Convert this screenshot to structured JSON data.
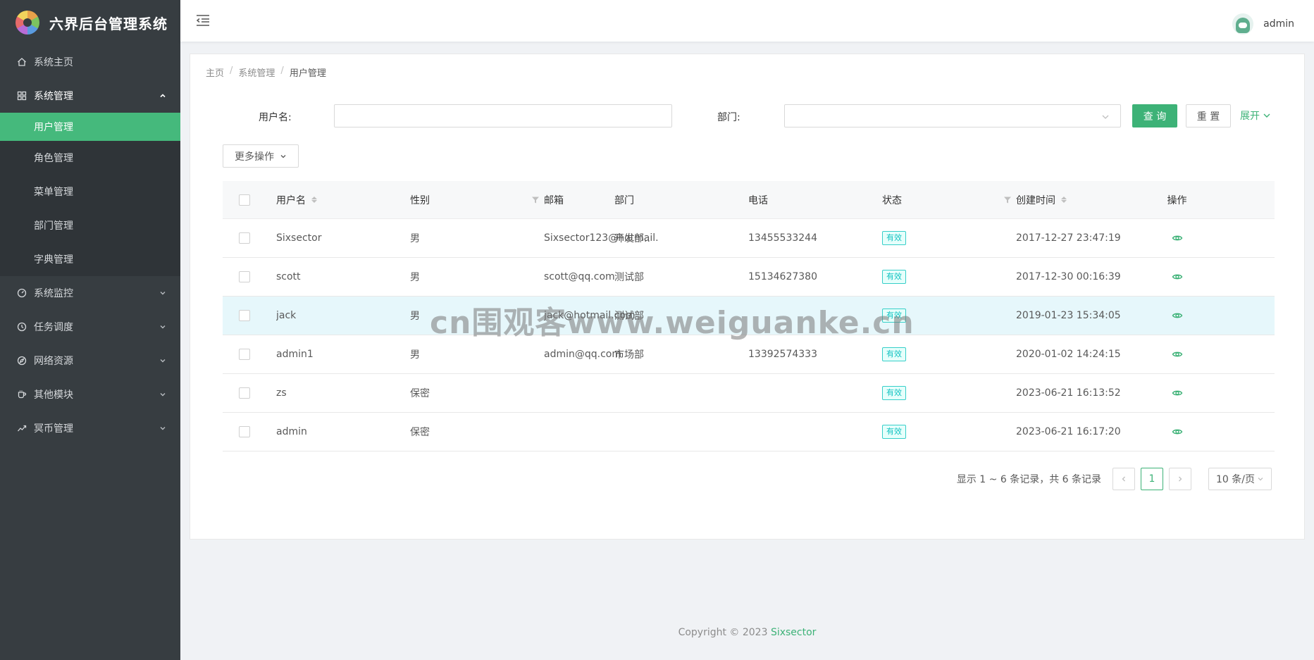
{
  "app": {
    "title": "六界后台管理系统"
  },
  "sidebar": {
    "items": [
      {
        "label": "系统主页",
        "icon": "home-icon"
      },
      {
        "label": "系统管理",
        "icon": "grid-icon",
        "expanded": true,
        "children": [
          {
            "label": "用户管理",
            "active": true
          },
          {
            "label": "角色管理"
          },
          {
            "label": "菜单管理"
          },
          {
            "label": "部门管理"
          },
          {
            "label": "字典管理"
          }
        ]
      },
      {
        "label": "系统监控",
        "icon": "dashboard-icon"
      },
      {
        "label": "任务调度",
        "icon": "clock-icon"
      },
      {
        "label": "网络资源",
        "icon": "compass-icon"
      },
      {
        "label": "其他模块",
        "icon": "coffee-icon"
      },
      {
        "label": "冥币管理",
        "icon": "line-chart-icon"
      }
    ]
  },
  "header": {
    "username": "admin"
  },
  "breadcrumb": {
    "home": "主页",
    "parent": "系统管理",
    "current": "用户管理",
    "sep": "/"
  },
  "search": {
    "username_label": "用户名:",
    "username_value": "",
    "dept_label": "部门:",
    "dept_value": "",
    "query_button": "查 询",
    "reset_button": "重 置",
    "expand_link": "展开"
  },
  "toolbar": {
    "more_actions": "更多操作"
  },
  "table": {
    "columns": {
      "username": "用户名",
      "sex": "性别",
      "email": "邮箱",
      "dept": "部门",
      "phone": "电话",
      "status": "状态",
      "created": "创建时间",
      "ops": "操作"
    },
    "rows": [
      {
        "username": "Sixsector",
        "sex": "男",
        "email": "Sixsector123@hotmail.",
        "dept": "开发部..",
        "phone": "13455533244",
        "status": "有效",
        "created": "2017-12-27 23:47:19"
      },
      {
        "username": "scott",
        "sex": "男",
        "email": "scott@qq.com",
        "dept": "测试部",
        "phone": "15134627380",
        "status": "有效",
        "created": "2017-12-30 00:16:39"
      },
      {
        "username": "jack",
        "sex": "男",
        "email": "jack@hotmail.com",
        "dept": "测试部",
        "phone": "",
        "status": "有效",
        "created": "2019-01-23 15:34:05"
      },
      {
        "username": "admin1",
        "sex": "男",
        "email": "admin@qq.com",
        "dept": "市场部",
        "phone": "13392574333",
        "status": "有效",
        "created": "2020-01-02 14:24:15"
      },
      {
        "username": "zs",
        "sex": "保密",
        "email": "",
        "dept": "",
        "phone": "",
        "status": "有效",
        "created": "2023-06-21 16:13:52"
      },
      {
        "username": "admin",
        "sex": "保密",
        "email": "",
        "dept": "",
        "phone": "",
        "status": "有效",
        "created": "2023-06-21 16:17:20"
      }
    ]
  },
  "pagination": {
    "total_text": "显示 1 ~ 6 条记录，共 6 条记录",
    "current_page": "1",
    "page_size": "10 条/页"
  },
  "footer": {
    "copyright": "Copyright © 2023",
    "brand": "Sixsector"
  },
  "watermark": {
    "text": "cn围观客www.weiguanke.cn"
  },
  "colors": {
    "primary": "#3db277",
    "sidebar_bg": "#373d41",
    "active_menu": "#45b97c",
    "status_badge": "#13c2c2"
  }
}
